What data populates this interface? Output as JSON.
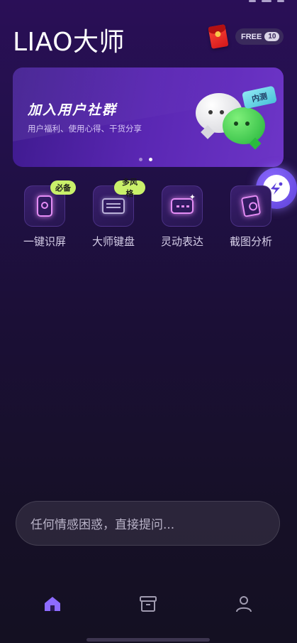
{
  "app": {
    "title": "LIAO大师"
  },
  "header": {
    "free_label": "FREE",
    "free_count": "10",
    "redpacket_icon": "red-envelope-icon"
  },
  "banner": {
    "title": "加入用户社群",
    "subtitle": "用户福利、使用心得、干货分享",
    "tag": "内测",
    "pages": 2,
    "active_page": 2
  },
  "tools": [
    {
      "label": "一键识屏",
      "badge": "必备",
      "icon": "phone-scan-icon"
    },
    {
      "label": "大师键盘",
      "badge": "多风格",
      "icon": "keyboard-icon"
    },
    {
      "label": "灵动表达",
      "badge": "",
      "icon": "sparkle-message-icon"
    },
    {
      "label": "截图分析",
      "badge": "",
      "icon": "screenshot-search-icon"
    }
  ],
  "ask": {
    "placeholder": "任何情感困惑，直接提问..."
  },
  "tabbar": {
    "items": [
      {
        "icon": "home-icon",
        "active": true
      },
      {
        "icon": "archive-icon",
        "active": false
      },
      {
        "icon": "profile-icon",
        "active": false
      }
    ]
  },
  "colors": {
    "accent": "#8d6bff",
    "badge": "#c9f06a",
    "glyph": "#e48cf5"
  }
}
